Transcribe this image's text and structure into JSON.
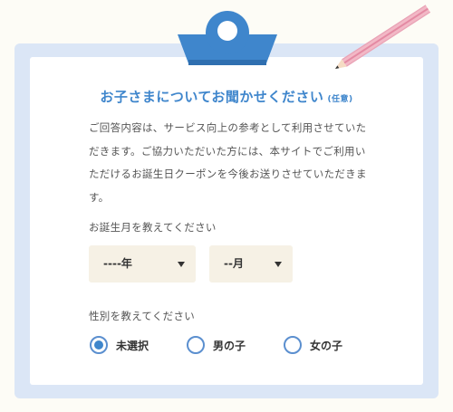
{
  "form": {
    "title": "お子さまについてお聞かせください",
    "optional_badge": "(任意)",
    "description": "ご回答内容は、サービス向上の参考として利用させていただきます。ご協力いただいた方には、本サイトでご利用いただけるお誕生日クーポンを今後お送りさせていただきます。",
    "birth_month_label": "お誕生月を教えてください",
    "year_select": {
      "value": "----年"
    },
    "month_select": {
      "value": "--月"
    },
    "gender_label": "性別を教えてください",
    "gender_options": [
      {
        "label": "未選択",
        "selected": true
      },
      {
        "label": "男の子",
        "selected": false
      },
      {
        "label": "女の子",
        "selected": false
      }
    ]
  },
  "colors": {
    "accent": "#3f86cc",
    "board": "#dbe6f6",
    "select_bg": "#f6f1e5",
    "pencil": "#f2b8c6"
  },
  "icons": [
    "clipboard-clip-icon",
    "pencil-icon",
    "dropdown-arrow-icon"
  ]
}
